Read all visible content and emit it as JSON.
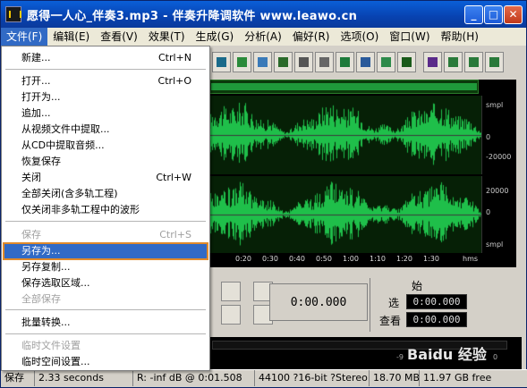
{
  "window": {
    "title": "愿得一人心_伴奏3.mp3 - 伴奏升降调软件 www.leawo.cn",
    "buttons": {
      "minimize": "_",
      "maximize": "□",
      "close": "✕"
    }
  },
  "menubar": {
    "items": [
      {
        "label": "文件(F)"
      },
      {
        "label": "编辑(E)"
      },
      {
        "label": "查看(V)"
      },
      {
        "label": "效果(T)"
      },
      {
        "label": "生成(G)"
      },
      {
        "label": "分析(A)"
      },
      {
        "label": "偏好(R)"
      },
      {
        "label": "选项(O)"
      },
      {
        "label": "窗口(W)"
      },
      {
        "label": "帮助(H)"
      }
    ]
  },
  "file_menu": {
    "items": [
      {
        "label": "新建...",
        "shortcut": "Ctrl+N",
        "disabled": false
      },
      {
        "label": "打开...",
        "shortcut": "Ctrl+O",
        "disabled": false
      },
      {
        "label": "打开为...",
        "shortcut": "",
        "disabled": false
      },
      {
        "label": "追加...",
        "shortcut": "",
        "disabled": false
      },
      {
        "label": "从视频文件中提取...",
        "shortcut": "",
        "disabled": false
      },
      {
        "label": "从CD中提取音频...",
        "shortcut": "",
        "disabled": false
      },
      {
        "label": "恢复保存",
        "shortcut": "",
        "disabled": false
      },
      {
        "label": "关闭",
        "shortcut": "Ctrl+W",
        "disabled": false
      },
      {
        "label": "全部关闭(含多轨工程)",
        "shortcut": "",
        "disabled": false
      },
      {
        "label": "仅关闭非多轨工程中的波形",
        "shortcut": "",
        "disabled": false
      },
      {
        "label": "保存",
        "shortcut": "Ctrl+S",
        "disabled": true
      },
      {
        "label": "另存为...",
        "shortcut": "",
        "disabled": false,
        "selected": true
      },
      {
        "label": "另存复制...",
        "shortcut": "",
        "disabled": false
      },
      {
        "label": "保存选取区域...",
        "shortcut": "",
        "disabled": false
      },
      {
        "label": "全部保存",
        "shortcut": "",
        "disabled": true
      },
      {
        "label": "批量转换...",
        "shortcut": "",
        "disabled": false
      },
      {
        "label": "临时文件设置",
        "shortcut": "",
        "disabled": true
      },
      {
        "label": "临时空间设置...",
        "shortcut": "",
        "disabled": false
      }
    ]
  },
  "scale": {
    "unit": "smpl",
    "top": [
      "smpl",
      "0",
      "-20000"
    ],
    "bottom": [
      "20000",
      "0",
      "smpl"
    ]
  },
  "timeruler": {
    "ticks": [
      "0:20",
      "0:30",
      "0:40",
      "0:50",
      "1:00",
      "1:10",
      "1:20",
      "1:30"
    ],
    "unit": "hms"
  },
  "transport": {
    "time": "0:00.000",
    "header": "始",
    "selection_label": "选",
    "selection_value": "0:00.000",
    "view_label": "查看",
    "view_value": "0:00.000"
  },
  "levels": {
    "ticks": [
      "-9",
      "-6",
      "-3",
      "0"
    ]
  },
  "statusbar": {
    "state": "保存",
    "duration": "2.33 seconds",
    "cursor": "R: -inf dB @  0:01.508",
    "format": "44100 ?16-bit ?Stereo",
    "size": "18.70 MB",
    "free": "11.97 GB free"
  },
  "watermark": "Baidu 经验"
}
